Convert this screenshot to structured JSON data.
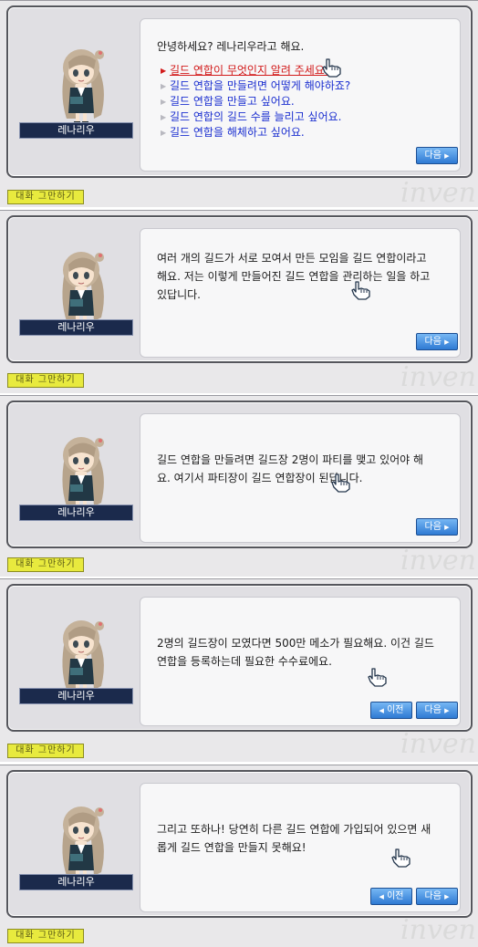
{
  "npc_name": "레나리우",
  "end_chat_label": "대화 그만하기",
  "next_label": "다음",
  "prev_label": "이전",
  "watermark": "inven",
  "dialogs": [
    {
      "text": "안녕하세요? 레나리우라고 해요.",
      "options": [
        "길드 연합이 무엇인지 알려 주세요.",
        "길드 연합을 만들려면 어떻게 해야하죠?",
        "길드 연합을 만들고 싶어요.",
        "길드 연합의 길드 수를 늘리고 싶어요.",
        "길드 연합을 해체하고 싶어요."
      ]
    },
    {
      "text": "여러 개의 길드가 서로 모여서 만든 모임을 길드 연합이라고\n해요. 저는 이렇게 만들어진 길드 연합을 관리하는 일을 하고\n있답니다."
    },
    {
      "text": "길드 연합을 만들려면 길드장 2명이 파티를 맺고 있어야 해\n요. 여기서 파티장이 길드 연합장이 된답니다."
    },
    {
      "text": "2명의 길드장이 모였다면 500만 메소가 필요해요. 이건 길드\n연합을 등록하는데 필요한 수수료에요."
    },
    {
      "text": "그리고 또하나! 당연히 다른 길드 연합에 가입되어 있으면 새\n롭게 길드 연합을 만들지 못해요!"
    }
  ],
  "colors": {
    "option_text": "#1b2fd0",
    "button": "#2f7ad3",
    "end_chat_button": "#e8ea3e",
    "name_tag": "#1b2a4c"
  }
}
